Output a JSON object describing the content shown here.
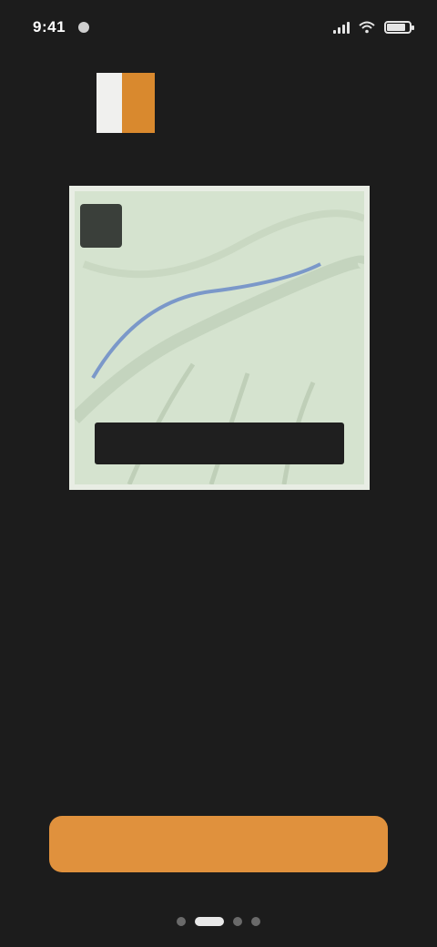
{
  "status_bar": {
    "time": "9:41",
    "battery_level": 0.85
  },
  "logo": {
    "left_text": "",
    "right_text": ""
  },
  "map_card": {
    "badge_text": "",
    "caption": ""
  },
  "onboarding": {
    "headline": "",
    "body": ""
  },
  "cta": {
    "label": ""
  },
  "pager": {
    "total": 4,
    "active_index": 1
  },
  "colors": {
    "accent": "#e0913d",
    "background": "#1c1c1c",
    "map_green": "#d5e3cf",
    "route_blue": "#7b98c9"
  }
}
